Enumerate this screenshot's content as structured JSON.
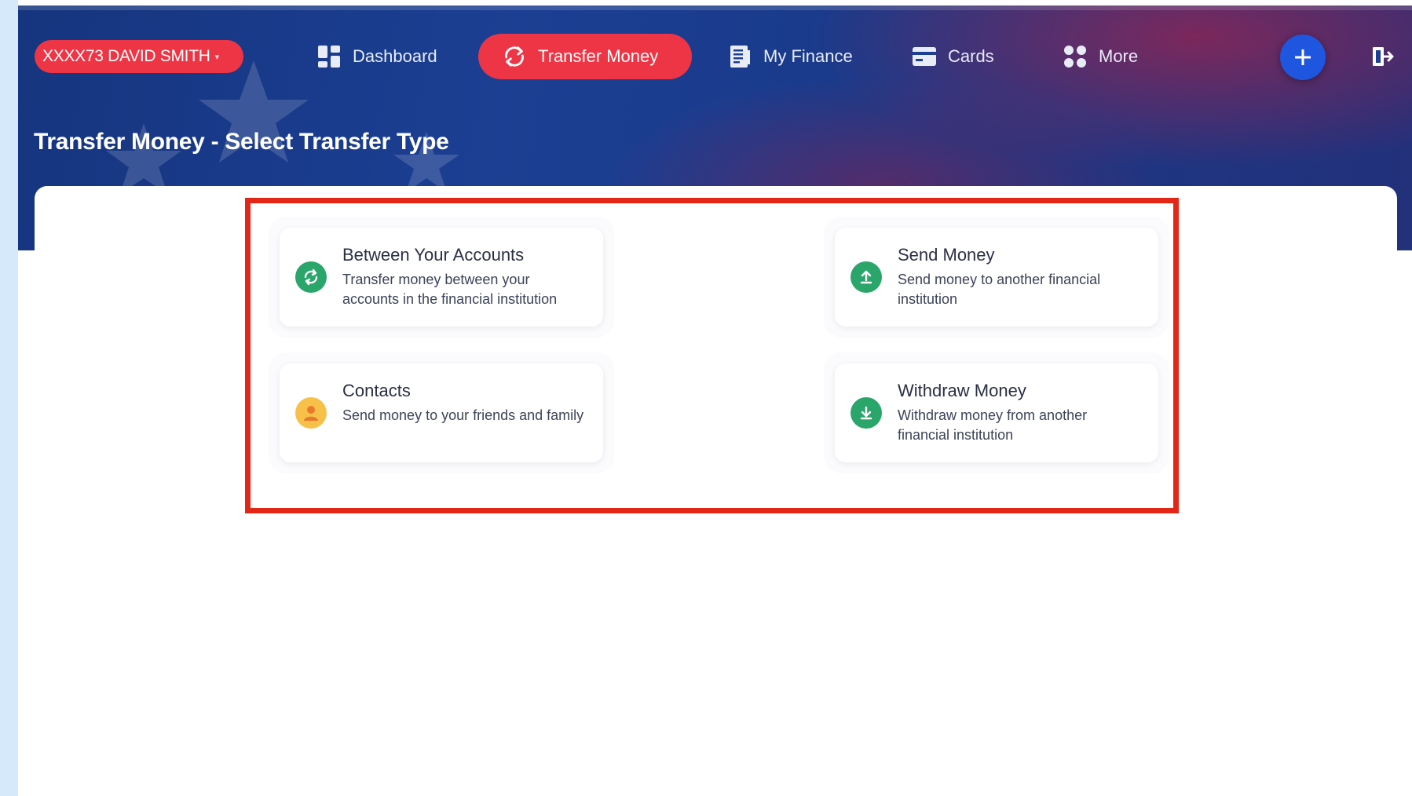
{
  "header": {
    "account_label": "XXXX73  DAVID SMITH",
    "nav": [
      {
        "label": "Dashboard",
        "icon": "dashboard-icon"
      },
      {
        "label": "Transfer Money",
        "icon": "transfer-icon",
        "active": true
      },
      {
        "label": "My Finance",
        "icon": "finance-icon"
      },
      {
        "label": "Cards",
        "icon": "card-icon"
      },
      {
        "label": "More",
        "icon": "more-grid-icon"
      }
    ],
    "plus_icon": "plus-icon",
    "logout_icon": "logout-icon"
  },
  "page": {
    "title": "Transfer Money - Select Transfer Type"
  },
  "options": [
    {
      "title": "Between Your Accounts",
      "description": "Transfer money between your accounts in the financial institution",
      "icon": "sync-arrows-icon",
      "color": "#2aa66b"
    },
    {
      "title": "Send Money",
      "description": "Send money to another financial institution",
      "icon": "upload-arrow-icon",
      "color": "#2aa66b"
    },
    {
      "title": "Contacts",
      "description": "Send money to your friends and family",
      "icon": "person-icon",
      "color": "#f7c149"
    },
    {
      "title": "Withdraw Money",
      "description": "Withdraw money from another financial institution",
      "icon": "download-arrow-icon",
      "color": "#2aa66b"
    }
  ],
  "colors": {
    "accent_red": "#ee3545",
    "highlight_border": "#e32716",
    "header_blue": "#1c3f93",
    "plus_blue": "#1f56e0"
  }
}
